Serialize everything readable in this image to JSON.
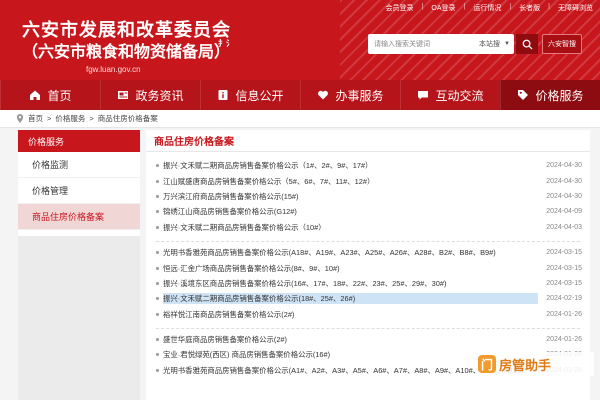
{
  "header": {
    "title": "六安市发展和改革委员会",
    "subtitle": "（六安市粮食和物资储备局）",
    "seal_text": "扌氵",
    "domain": "fgw.luan.gov.cn",
    "toplinks": [
      "会员登录",
      "OA登录",
      "运行情况",
      "长者版",
      "无障碍浏览"
    ],
    "search_placeholder": "请输入搜索关键词",
    "search_scope": "本站搜",
    "ai_label": "六安智搜"
  },
  "nav": {
    "items": [
      {
        "label": "首页",
        "icon": "home-icon"
      },
      {
        "label": "政务资讯",
        "icon": "news-icon"
      },
      {
        "label": "信息公开",
        "icon": "info-icon"
      },
      {
        "label": "办事服务",
        "icon": "heart-hand-icon"
      },
      {
        "label": "互动交流",
        "icon": "chat-icon"
      },
      {
        "label": "价格服务",
        "icon": "price-icon"
      }
    ]
  },
  "breadcrumb": [
    "首页",
    "价格服务",
    "商品住房价格备案"
  ],
  "sidebar": {
    "title": "价格服务",
    "items": [
      "价格监测",
      "价格管理",
      "商品住房价格备案"
    ]
  },
  "main": {
    "title": "商品住房价格备案",
    "groups": [
      [
        {
          "title": "振兴·文禾赋二期商品房销售备案价格公示（1#、2#、9#、17#）",
          "date": "2024-04-30"
        },
        {
          "title": "江山赋盛唐商品房销售备案价格公示（5#、6#、7#、11#、12#）",
          "date": "2024-04-30"
        },
        {
          "title": "万兴滨江府商品房销售备案价格公示(15#)",
          "date": "2024-04-30"
        },
        {
          "title": "锦绣江山商品房销售备案价格公示(G12#)",
          "date": "2024-04-09"
        },
        {
          "title": "振兴·文禾赋二期商品房销售备案价格公示（10#）",
          "date": "2024-04-03"
        }
      ],
      [
        {
          "title": "光明书香雅苑商品房销售备案价格公示(A18#、A19#、A23#、A25#、A26#、A28#、B2#、B8#、B9#)",
          "date": "2024-03-15"
        },
        {
          "title": "恒远·汇金广场商品房销售备案价格公示(8#、9#、10#)",
          "date": "2024-03-15"
        },
        {
          "title": "振兴·溪境东区商品房销售备案价格公示(16#、17#、18#、22#、23#、25#、29#、30#)",
          "date": "2024-03-15"
        },
        {
          "title": "振兴·文禾赋二期商品房销售备案价格公示(18#、25#、26#)",
          "date": "2024-02-19"
        },
        {
          "title": "裕祥悦江南商品房销售备案价格公示(2#)",
          "date": "2024-01-26"
        }
      ],
      [
        {
          "title": "盛世华庭商品房销售备案价格公示(2#)",
          "date": "2024-01-26"
        },
        {
          "title": "宝业·君悦绿苑(西区) 商品房销售备案价格公示(16#)",
          "date": "2024-01-26"
        },
        {
          "title": "光明书香雅苑商品房销售备案价格公示(A1#、A2#、A3#、A5#、A6#、A7#、A8#、A9#、A10#、A11#、A12#",
          "date": "2024-01-26"
        }
      ]
    ]
  },
  "watermark": {
    "text": "房管助手",
    "icon_text": "门"
  },
  "colors": {
    "primary": "#c8161d",
    "nav": "#b5141b",
    "nav_active": "#8d0c11"
  }
}
